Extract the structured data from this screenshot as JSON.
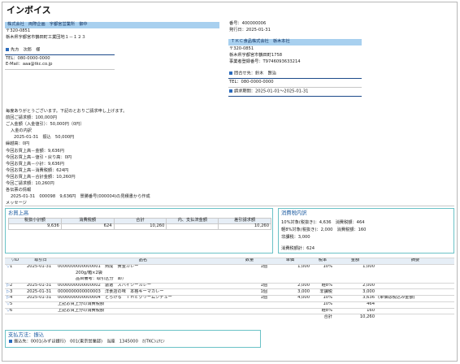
{
  "header": {
    "title": "インボイス"
  },
  "recipient": {
    "company": "株式会社　両際企画　宇都宮営業所　御中",
    "postal": "〒320-0851",
    "address": "栃木県宇都宮市鶴田町工業団地１－１２３",
    "contact_label": "先方　次郎　様",
    "tel": "TEL：080-0000-0000",
    "email": "E-Mail：aaa@tkc.co.jp"
  },
  "meta": {
    "number": "番号：400000006",
    "issue_date": "発行日：2025-01-31"
  },
  "issuer": {
    "company": "ＴＫＣ食品株式会社　栃木本社",
    "postal": "〒320-0851",
    "address": "栃木県宇都宮市鶴田町1758",
    "reg_no": "事業者登録番号：T9746093633214",
    "contact_label": "問合せ先：鈴木　賢治",
    "tel": "TEL：080-0000-0000",
    "period": "請求期間：2025-01-01～2025-01-31"
  },
  "message": {
    "lines": [
      "毎度ありがとうございます。下記のとおりご請求申し上げます。",
      "前回ご請求額：100,000円",
      "ご入金額（入金値引）：50,000円（0円）",
      "入金の内訳",
      "2025-01-31　振込　50,000円",
      "繰越高：0円",
      "今回お買上高－金額：9,636円",
      "今回お買上高－値引・戻り高：0円",
      "今回お買上高－小計：9,636円",
      "今回お買上高－消費税額：624円",
      "今回お買上高－合計金額：10,260円",
      "今回ご請求額：10,260円",
      "各伝票の情報",
      "2025-01-31　000098　9,636円　景勝番号(000004)の見積書から作成"
    ],
    "label": "メッセージ"
  },
  "purchase": {
    "title": "お買上高",
    "headers": [
      "税抜小計額",
      "消費税額",
      "合計",
      "内、支払済金額",
      "差引請求額"
    ],
    "values": [
      "9,636",
      "624",
      "10,260",
      "",
      "10,260"
    ]
  },
  "tax": {
    "title": "消費税内訳",
    "lines": [
      "10%対象(税抜き)：4,636　消費税額：464",
      "軽8%対象(税抜き)：2,000　消費税額：160",
      "非課税：3,000",
      "消費税額計：624"
    ]
  },
  "items": {
    "headers": [
      "▽ID",
      "取引日",
      "品名",
      "数量",
      "単価",
      "税率",
      "金額",
      "摘要"
    ],
    "rows": [
      {
        "id": "1",
        "date": "2025-01-31",
        "name": "0000000000000001　熟成　黄金カレー",
        "sub1": "200g/箱×2袋",
        "sub2": "品目備考：取引区分　卸）",
        "qty": "1個",
        "price": "1,000",
        "rate": "10%",
        "amount": "1,000",
        "note": ""
      },
      {
        "id": "2",
        "date": "2025-01-31",
        "name": "0000000000000002　激選　スパイシーカレー",
        "qty": "1個",
        "price": "2,000",
        "rate": "軽8%",
        "amount": "2,000",
        "note": ""
      },
      {
        "id": "3",
        "date": "2025-01-31",
        "name": "0000000000000003　洋食店の味　本格キーマカレー",
        "qty": "1個",
        "price": "3,000",
        "rate": "非課税",
        "amount": "3,000",
        "note": ""
      },
      {
        "id": "4",
        "date": "2025-01-31",
        "name": "0000000000000004　とろける　ＴＨＥクリームシチュー",
        "qty": "1個",
        "price": "4,000",
        "rate": "10%",
        "amount": "3,636",
        "note": "(単価は税込み金額)"
      },
      {
        "id": "5",
        "date": "",
        "name": "上記お買上分の消費税額",
        "qty": "",
        "price": "",
        "rate": "10%",
        "amount": "464",
        "note": ""
      },
      {
        "id": "6",
        "date": "",
        "name": "上記お買上分の消費税額",
        "qty": "",
        "price": "",
        "rate": "軽8%",
        "amount": "160",
        "note": ""
      },
      {
        "id": "",
        "date": "",
        "name": "",
        "qty": "",
        "price": "",
        "rate": "合計",
        "amount": "10,260",
        "note": ""
      }
    ]
  },
  "payment": {
    "title": "支払方法：振込",
    "detail": "振込先：0001(みずほ銀行)　001(東京営業部)　当座　1345000　ｶ)TKCｼｮｸﾋﾝ"
  },
  "colors": {
    "accent_bar": "#a8d0ef",
    "panel_border": "#6bc2c7",
    "rule": "#1c4a8a"
  }
}
